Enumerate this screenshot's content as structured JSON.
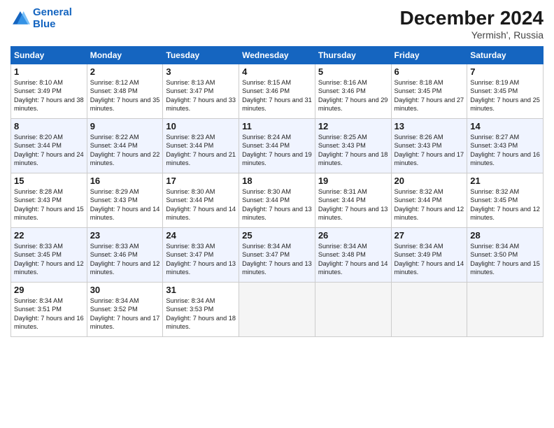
{
  "logo": {
    "line1": "General",
    "line2": "Blue"
  },
  "title": "December 2024",
  "subtitle": "Yermish', Russia",
  "headers": [
    "Sunday",
    "Monday",
    "Tuesday",
    "Wednesday",
    "Thursday",
    "Friday",
    "Saturday"
  ],
  "weeks": [
    [
      {
        "num": "1",
        "sunrise": "8:10 AM",
        "sunset": "3:49 PM",
        "daylight": "7 hours and 38 minutes."
      },
      {
        "num": "2",
        "sunrise": "8:12 AM",
        "sunset": "3:48 PM",
        "daylight": "7 hours and 35 minutes."
      },
      {
        "num": "3",
        "sunrise": "8:13 AM",
        "sunset": "3:47 PM",
        "daylight": "7 hours and 33 minutes."
      },
      {
        "num": "4",
        "sunrise": "8:15 AM",
        "sunset": "3:46 PM",
        "daylight": "7 hours and 31 minutes."
      },
      {
        "num": "5",
        "sunrise": "8:16 AM",
        "sunset": "3:46 PM",
        "daylight": "7 hours and 29 minutes."
      },
      {
        "num": "6",
        "sunrise": "8:18 AM",
        "sunset": "3:45 PM",
        "daylight": "7 hours and 27 minutes."
      },
      {
        "num": "7",
        "sunrise": "8:19 AM",
        "sunset": "3:45 PM",
        "daylight": "7 hours and 25 minutes."
      }
    ],
    [
      {
        "num": "8",
        "sunrise": "8:20 AM",
        "sunset": "3:44 PM",
        "daylight": "7 hours and 24 minutes."
      },
      {
        "num": "9",
        "sunrise": "8:22 AM",
        "sunset": "3:44 PM",
        "daylight": "7 hours and 22 minutes."
      },
      {
        "num": "10",
        "sunrise": "8:23 AM",
        "sunset": "3:44 PM",
        "daylight": "7 hours and 21 minutes."
      },
      {
        "num": "11",
        "sunrise": "8:24 AM",
        "sunset": "3:44 PM",
        "daylight": "7 hours and 19 minutes."
      },
      {
        "num": "12",
        "sunrise": "8:25 AM",
        "sunset": "3:43 PM",
        "daylight": "7 hours and 18 minutes."
      },
      {
        "num": "13",
        "sunrise": "8:26 AM",
        "sunset": "3:43 PM",
        "daylight": "7 hours and 17 minutes."
      },
      {
        "num": "14",
        "sunrise": "8:27 AM",
        "sunset": "3:43 PM",
        "daylight": "7 hours and 16 minutes."
      }
    ],
    [
      {
        "num": "15",
        "sunrise": "8:28 AM",
        "sunset": "3:43 PM",
        "daylight": "7 hours and 15 minutes."
      },
      {
        "num": "16",
        "sunrise": "8:29 AM",
        "sunset": "3:43 PM",
        "daylight": "7 hours and 14 minutes."
      },
      {
        "num": "17",
        "sunrise": "8:30 AM",
        "sunset": "3:44 PM",
        "daylight": "7 hours and 14 minutes."
      },
      {
        "num": "18",
        "sunrise": "8:30 AM",
        "sunset": "3:44 PM",
        "daylight": "7 hours and 13 minutes."
      },
      {
        "num": "19",
        "sunrise": "8:31 AM",
        "sunset": "3:44 PM",
        "daylight": "7 hours and 13 minutes."
      },
      {
        "num": "20",
        "sunrise": "8:32 AM",
        "sunset": "3:44 PM",
        "daylight": "7 hours and 12 minutes."
      },
      {
        "num": "21",
        "sunrise": "8:32 AM",
        "sunset": "3:45 PM",
        "daylight": "7 hours and 12 minutes."
      }
    ],
    [
      {
        "num": "22",
        "sunrise": "8:33 AM",
        "sunset": "3:45 PM",
        "daylight": "7 hours and 12 minutes."
      },
      {
        "num": "23",
        "sunrise": "8:33 AM",
        "sunset": "3:46 PM",
        "daylight": "7 hours and 12 minutes."
      },
      {
        "num": "24",
        "sunrise": "8:33 AM",
        "sunset": "3:47 PM",
        "daylight": "7 hours and 13 minutes."
      },
      {
        "num": "25",
        "sunrise": "8:34 AM",
        "sunset": "3:47 PM",
        "daylight": "7 hours and 13 minutes."
      },
      {
        "num": "26",
        "sunrise": "8:34 AM",
        "sunset": "3:48 PM",
        "daylight": "7 hours and 14 minutes."
      },
      {
        "num": "27",
        "sunrise": "8:34 AM",
        "sunset": "3:49 PM",
        "daylight": "7 hours and 14 minutes."
      },
      {
        "num": "28",
        "sunrise": "8:34 AM",
        "sunset": "3:50 PM",
        "daylight": "7 hours and 15 minutes."
      }
    ],
    [
      {
        "num": "29",
        "sunrise": "8:34 AM",
        "sunset": "3:51 PM",
        "daylight": "7 hours and 16 minutes."
      },
      {
        "num": "30",
        "sunrise": "8:34 AM",
        "sunset": "3:52 PM",
        "daylight": "7 hours and 17 minutes."
      },
      {
        "num": "31",
        "sunrise": "8:34 AM",
        "sunset": "3:53 PM",
        "daylight": "7 hours and 18 minutes."
      },
      null,
      null,
      null,
      null
    ]
  ]
}
